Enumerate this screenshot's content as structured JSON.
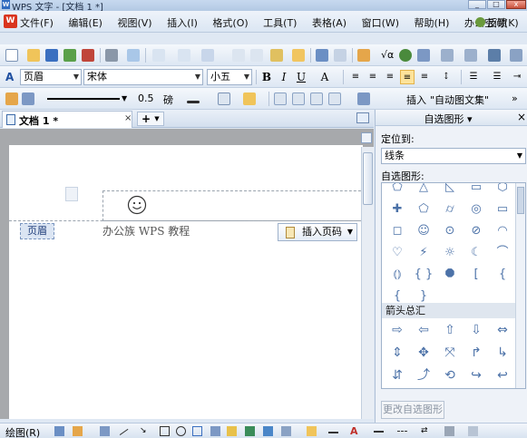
{
  "window": {
    "title": "WPS 文字 - [文档 1 *]",
    "min_label": "_",
    "max_label": "□",
    "close_label": "x"
  },
  "menubar": {
    "items": [
      "文件(F)",
      "编辑(E)",
      "视图(V)",
      "插入(I)",
      "格式(O)",
      "工具(T)",
      "表格(A)",
      "窗口(W)",
      "帮助(H)",
      "办公空间(K)"
    ],
    "feedback": "反馈"
  },
  "format_toolbar": {
    "style_value": "页眉",
    "font_value": "宋体",
    "size_value": "小五",
    "bold": "B",
    "italic": "I",
    "underline": "U",
    "font_color_label": "A"
  },
  "drawing_toolbar_top": {
    "line_width": "0.5",
    "line_unit": "磅",
    "insert_label": "插入",
    "autoshape_label": "\"自动图文集\""
  },
  "tabs": {
    "doc_tab": "文档 1 *",
    "close_symbol": "×",
    "new_tab": "+"
  },
  "document": {
    "header_label": "页眉",
    "header_text": "办公族 WPS 教程",
    "insert_page_number": "插入页码"
  },
  "taskpane": {
    "title": "自选图形",
    "locate_label": "定位到:",
    "locate_value": "线条",
    "autoshape_label": "自选图形:",
    "section_arrows": "箭头总汇",
    "edit_button": "更改自选图形",
    "basic_shapes": [
      "⬠",
      "△",
      "◺",
      "▭",
      "⬡",
      "✚",
      "⬠",
      "⌭",
      "◎",
      "▭",
      "◻",
      "☺",
      "⊙",
      "⊘",
      "◠",
      "♡",
      "⚡",
      "☼",
      "☾",
      "⌒",
      "⦅⦆",
      "{ }",
      "⯃",
      "[",
      "{",
      "{",
      "}"
    ],
    "arrow_shapes": [
      "⇨",
      "⇦",
      "⇧",
      "⇩",
      "⇔",
      "⇕",
      "✥",
      "⤧",
      "↱",
      "↳",
      "⇵",
      "⤴",
      "⟲",
      "↪",
      "↩"
    ]
  },
  "status": {
    "draw_label": "绘图(R)"
  },
  "colors": {
    "accent": "#4c72a8",
    "highlight": "#fde39a",
    "wps_red": "#d9341e"
  }
}
